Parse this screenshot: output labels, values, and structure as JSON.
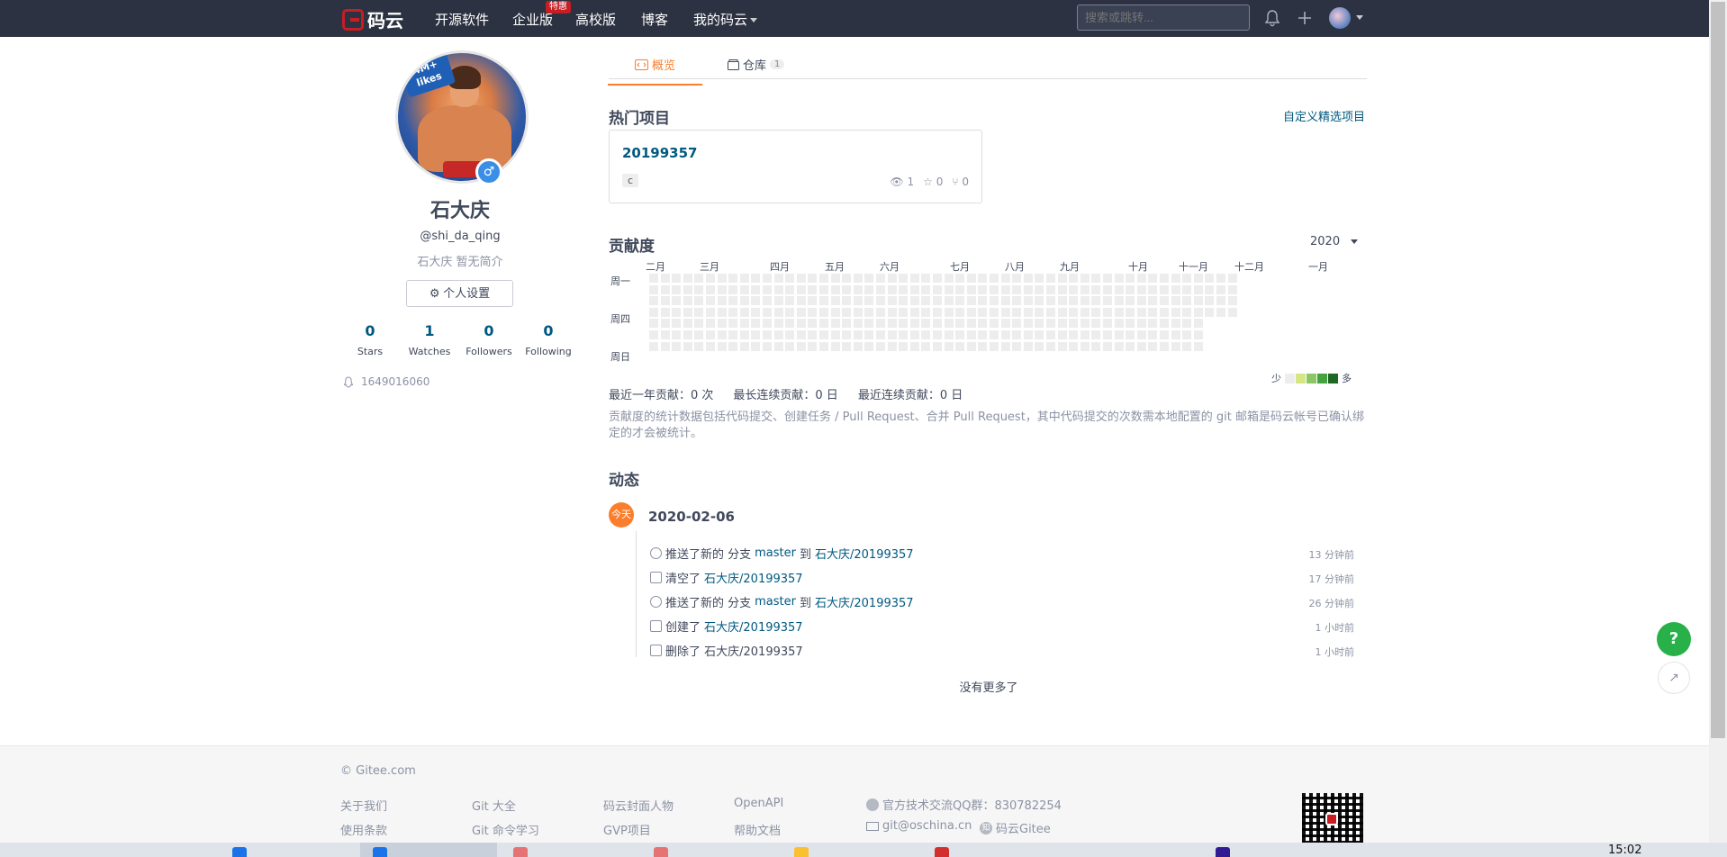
{
  "nav": {
    "logo_text": "码云",
    "items": [
      {
        "label": "开源软件"
      },
      {
        "label": "企业版"
      },
      {
        "label": "高校版"
      },
      {
        "label": "博客"
      },
      {
        "label": "我的码云"
      }
    ],
    "badge": "特惠",
    "search_placeholder": "搜索或跳转...",
    "colors": {
      "bg": "#2c3241",
      "brand": "#c71d23"
    }
  },
  "profile": {
    "avatar_text": "4M+ likes",
    "gender_symbol": "♂",
    "name": "石大庆",
    "handle": "@shi_da_qing",
    "bio": "石大庆 暂无简介",
    "settings_label": "个人设置",
    "stats": [
      {
        "num": "0",
        "label": "Stars"
      },
      {
        "num": "1",
        "label": "Watches"
      },
      {
        "num": "0",
        "label": "Followers"
      },
      {
        "num": "0",
        "label": "Following"
      }
    ],
    "qq": "1649016060"
  },
  "tabs": [
    {
      "label": "概览"
    },
    {
      "label": "仓库",
      "count": "1"
    }
  ],
  "hot": {
    "title": "热门项目",
    "customize": "自定义精选项目",
    "project": {
      "name": "20199357",
      "lang": "c",
      "watch": "1",
      "star": "0",
      "fork": "0"
    }
  },
  "contrib": {
    "title": "贡献度",
    "year": "2020",
    "months": [
      "二月",
      "三月",
      "四月",
      "五月",
      "六月",
      "七月",
      "八月",
      "九月",
      "十月",
      "十一月",
      "十二月",
      "一月"
    ],
    "days": [
      "周一",
      "周四",
      "周日"
    ],
    "legend_less": "少",
    "legend_more": "多",
    "legend_colors": [
      "#ededed",
      "#d6e685",
      "#8cc665",
      "#44a340",
      "#1e6823"
    ],
    "summary": [
      "最近一年贡献：0 次",
      "最长连续贡献：0 日",
      "最近连续贡献：0 日"
    ],
    "note": "贡献度的统计数据包括代码提交、创建任务 / Pull Request、合并 Pull Request，其中代码提交的次数需本地配置的 git 邮箱是码云帐号已确认绑定的才会被统计。"
  },
  "feed": {
    "title": "动态",
    "today": "今天",
    "date": "2020-02-06",
    "items": [
      {
        "prefix": "推送了新的 分支",
        "branch": "master",
        "mid": "到",
        "repo": "石大庆/20199357",
        "time": "13 分钟前"
      },
      {
        "prefix": "清空了",
        "branch": "",
        "mid": "",
        "repo": "石大庆/20199357",
        "time": "17 分钟前"
      },
      {
        "prefix": "推送了新的 分支",
        "branch": "master",
        "mid": "到",
        "repo": "石大庆/20199357",
        "time": "26 分钟前"
      },
      {
        "prefix": "创建了",
        "branch": "",
        "mid": "",
        "repo": "石大庆/20199357",
        "time": "1 小时前"
      },
      {
        "prefix": "删除了 石大庆/20199357",
        "branch": "",
        "mid": "",
        "repo": "",
        "time": "1 小时前"
      }
    ],
    "no_more": "没有更多了"
  },
  "float": {
    "help": "?",
    "share": "↗"
  },
  "footer": {
    "copyright": "© Gitee.com",
    "col1": [
      "关于我们",
      "使用条款"
    ],
    "col2": [
      "Git 大全",
      "Git 命令学习"
    ],
    "col3": [
      "码云封面人物",
      "GVP项目"
    ],
    "col4": [
      "OpenAPI",
      "帮助文档"
    ],
    "qq_group": "官方技术交流QQ群：830782254",
    "email": "git@oschina.cn",
    "zhihu": "码云Gitee"
  },
  "taskbar": {
    "time": "15:02"
  }
}
